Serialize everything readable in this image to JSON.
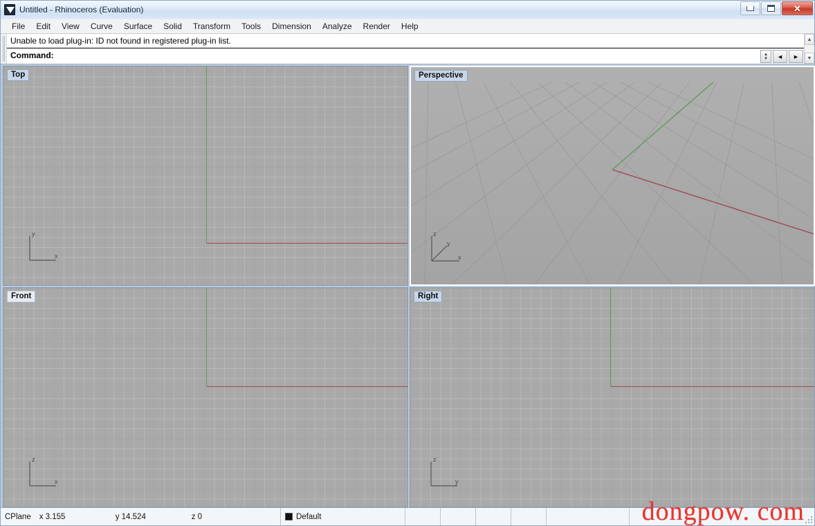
{
  "window": {
    "title": "Untitled - Rhinoceros (Evaluation)",
    "icon": "rhino-app-icon",
    "controls": {
      "minimize_label": "–",
      "maximize_label": "□",
      "close_label": "✕"
    }
  },
  "menubar": {
    "items": [
      {
        "label": "File"
      },
      {
        "label": "Edit"
      },
      {
        "label": "View"
      },
      {
        "label": "Curve"
      },
      {
        "label": "Surface"
      },
      {
        "label": "Solid"
      },
      {
        "label": "Transform"
      },
      {
        "label": "Tools"
      },
      {
        "label": "Dimension"
      },
      {
        "label": "Analyze"
      },
      {
        "label": "Render"
      },
      {
        "label": "Help"
      }
    ]
  },
  "command_area": {
    "history_line": "Unable to load plug-in: ID not found in registered plug-in list.",
    "prompt_label": "Command:",
    "prompt_value": "",
    "prompt_placeholder": "",
    "scroll_up_glyph": "▲",
    "scroll_down_glyph": "▼",
    "nav_prev_glyph": "◄",
    "nav_next_glyph": "►",
    "spin_up_glyph": "▲",
    "spin_down_glyph": "▼"
  },
  "viewports": [
    {
      "name": "Top",
      "label": "Top",
      "active": false,
      "projection": "orthographic",
      "gizmo": {
        "type": "2d",
        "vertical_axis": "y",
        "horizontal_axis": "x"
      }
    },
    {
      "name": "Perspective",
      "label": "Perspective",
      "active": true,
      "projection": "perspective",
      "gizmo": {
        "type": "3d",
        "up_axis": "z",
        "depth_axis": "y",
        "right_axis": "x"
      }
    },
    {
      "name": "Front",
      "label": "Front",
      "active": false,
      "projection": "orthographic",
      "gizmo": {
        "type": "2d",
        "vertical_axis": "z",
        "horizontal_axis": "x"
      }
    },
    {
      "name": "Right",
      "label": "Right",
      "active": false,
      "projection": "orthographic",
      "gizmo": {
        "type": "2d",
        "vertical_axis": "z",
        "horizontal_axis": "y"
      }
    }
  ],
  "statusbar": {
    "cplane_label": "CPlane",
    "x_label": "x 3.155",
    "y_label": "y 14.524",
    "z_label": "z 0",
    "layer_name": "Default",
    "layer_color": "#111111",
    "panes": [
      "",
      "",
      "",
      "",
      ""
    ]
  },
  "watermark": {
    "text": "dongpow. com",
    "color": "#e8352e"
  },
  "colors": {
    "axis_x": "#9e4a55",
    "axis_y": "#5f9c5f",
    "viewport_bg": "#a9a9a9",
    "grid_minor": "#9a9a9a",
    "grid_major": "#787878"
  }
}
